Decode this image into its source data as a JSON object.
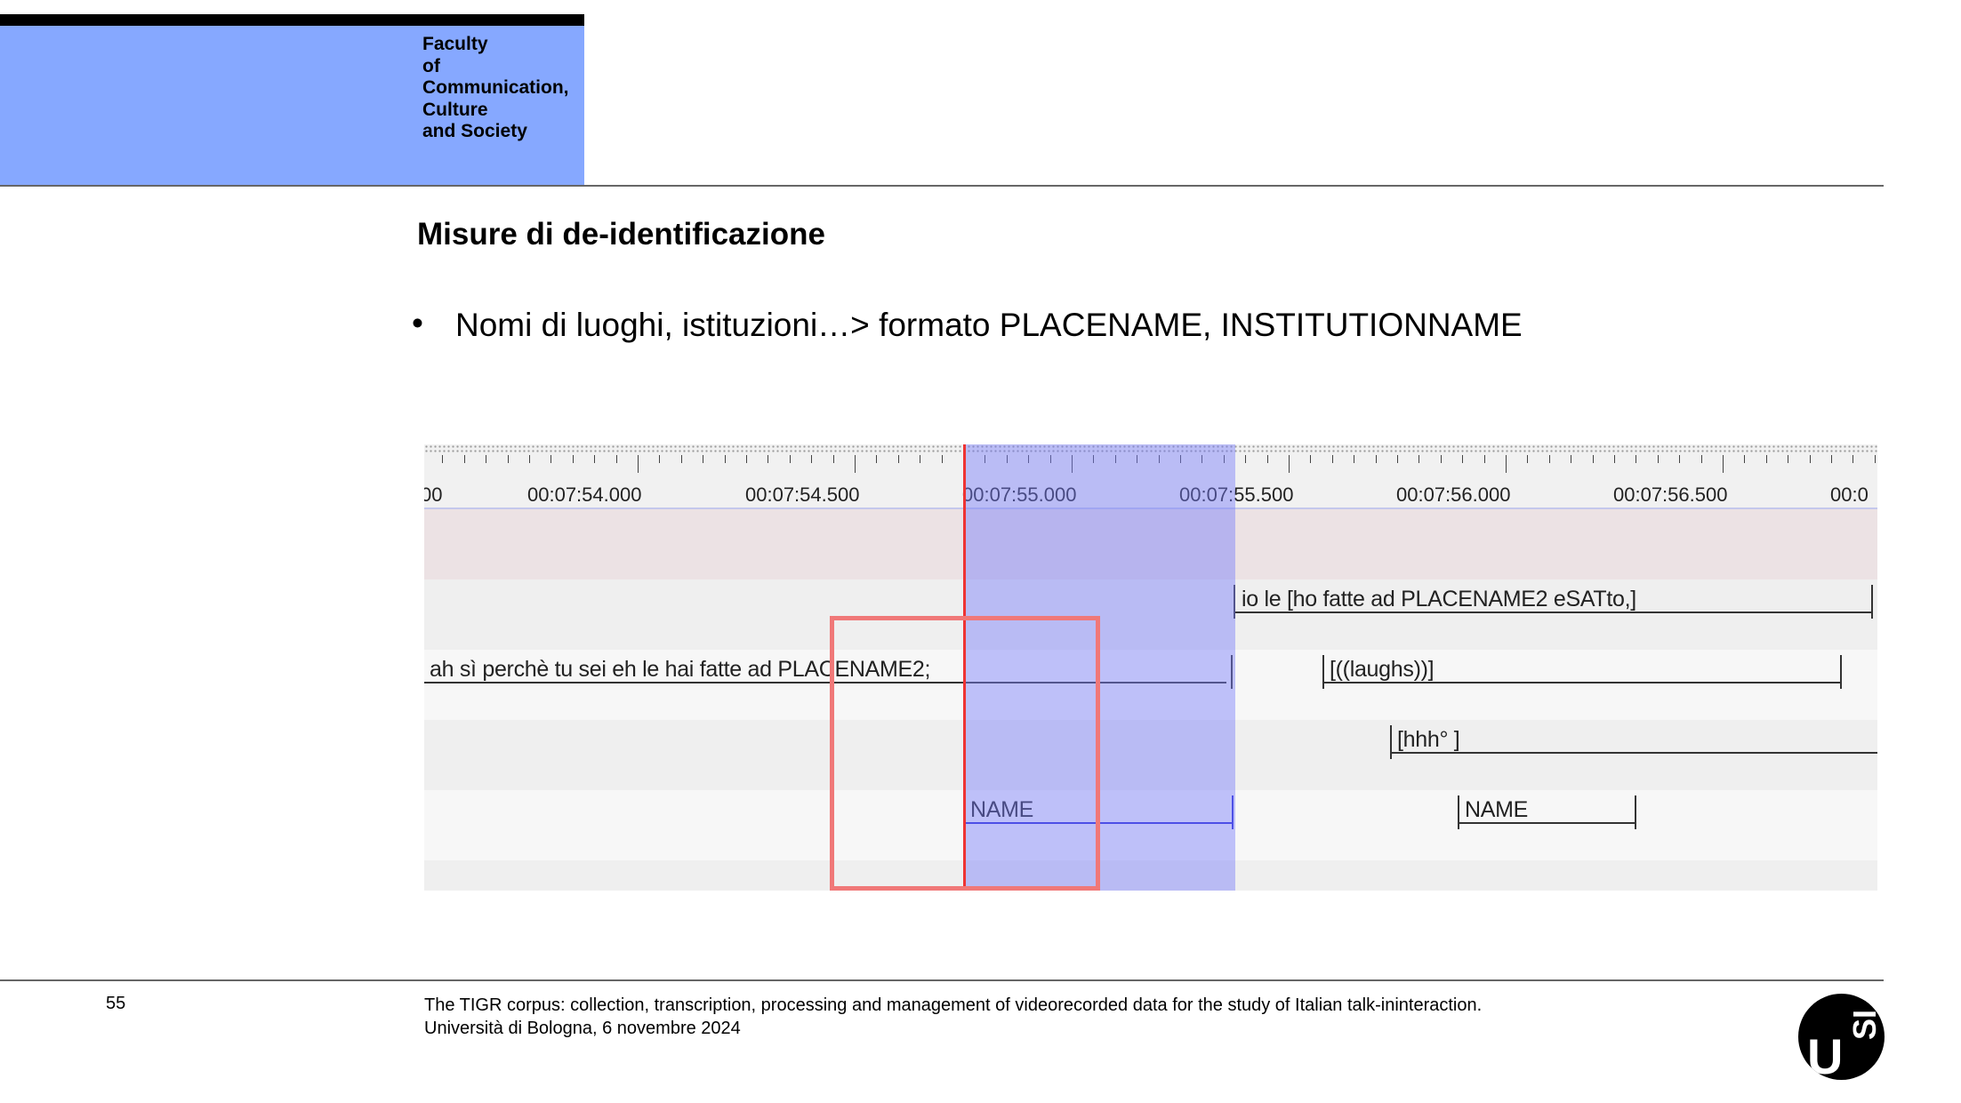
{
  "header": {
    "faculty_lines": [
      "Faculty",
      "of",
      "Communication,",
      "Culture",
      "and Society"
    ]
  },
  "slide": {
    "title": "Misure di de-identificazione",
    "bullet_symbol": "•",
    "bullet_text": "Nomi di luoghi, istituzioni…> formato PLACENAME, INSTITUTIONNAME"
  },
  "timeline": {
    "ticks": [
      "00",
      "00:07:54.000",
      "00:07:54.500",
      "00:07:55.000",
      "00:07:55.500",
      "00:07:56.000",
      "00:07:56.500",
      "00:0"
    ],
    "tier1_annotation": "io le [ho fatte ad PLACENAME2 eSATto,]",
    "tier2_annotation_a": "ah sì perchè tu sei eh le hai fatte ad PLACENAME2;",
    "tier2_annotation_b": "[((laughs))]",
    "tier3_annotation": "[hhh° ]",
    "tier4_annotation_a": "NAME",
    "tier4_annotation_b": "NAME",
    "colors": {
      "selection": "#c9cafa",
      "cursor": "#e33333",
      "highlight_box": "#f07878",
      "ruler_tier_band": "#ece2e4"
    }
  },
  "footer": {
    "page_number": "55",
    "line1": "The TIGR corpus: collection, transcription, processing and management of videorecorded data for the study of Italian talk-ininteraction.",
    "line2": "Università di Bologna, 6 novembre 2024"
  },
  "logo": {
    "letter_u": "U",
    "letters_si": "SI"
  }
}
